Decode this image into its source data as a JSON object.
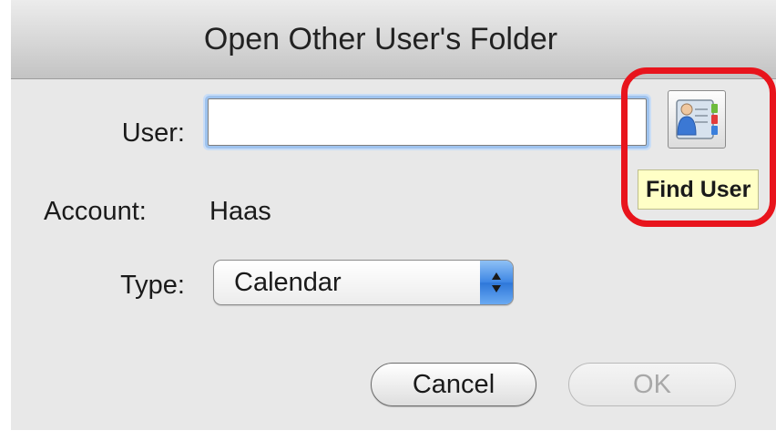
{
  "window": {
    "title": "Open Other User's Folder"
  },
  "form": {
    "user_label": "User:",
    "user_value": "",
    "account_label": "Account:",
    "account_value": "Haas",
    "type_label": "Type:",
    "type_selected": "Calendar"
  },
  "find_user": {
    "tooltip": "Find User",
    "icon": "address-book-person-icon"
  },
  "buttons": {
    "cancel": "Cancel",
    "ok": "OK"
  },
  "colors": {
    "highlight": "#e8141c",
    "tooltip_bg": "#ffffc6",
    "accent": "#3d86e4"
  }
}
